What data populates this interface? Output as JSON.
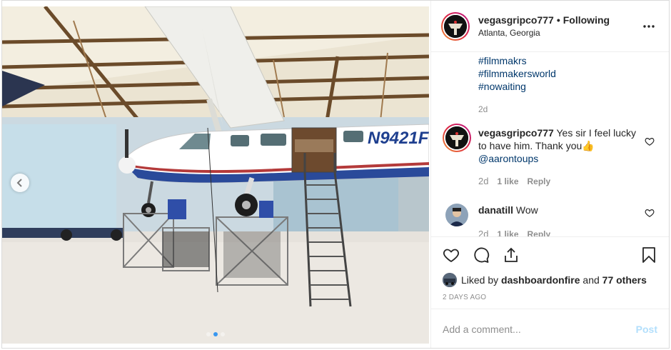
{
  "photo": {
    "aircraft_registration": "N9421F",
    "alt": "photo-carousel-image"
  },
  "header": {
    "username": "vegasgripco777",
    "separator": "•",
    "follow_status": "Following",
    "location": "Atlanta, Georgia"
  },
  "caption": {
    "hashtags": [
      "#filmmakrs",
      "#filmmakersworld",
      "#nowaiting"
    ],
    "age": "2d"
  },
  "comments": [
    {
      "username": "vegasgripco777",
      "text": "Yes sir I feel lucky to have him. Thank you👍",
      "mention": "@aarontoups",
      "age": "2d",
      "likes": "1 like",
      "reply_label": "Reply"
    },
    {
      "username": "danatill",
      "text": "Wow",
      "age": "2d",
      "likes": "1 like",
      "reply_label": "Reply"
    }
  ],
  "engagement": {
    "liked_prefix": "Liked by",
    "liked_user": "dashboardonfire",
    "liked_and": "and",
    "liked_others": "77 others",
    "date": "2 DAYS AGO"
  },
  "add_comment": {
    "placeholder": "Add a comment...",
    "post_label": "Post"
  },
  "colors": {
    "link": "#00376b",
    "muted": "#8e8e8e",
    "post_disabled": "#b2dffc",
    "carousel_dot_active": "#3897f0"
  },
  "icons": [
    "chevron-left-icon",
    "more-horizontal-icon",
    "heart-icon",
    "comment-icon",
    "share-icon",
    "bookmark-icon",
    "heart-small-icon"
  ]
}
